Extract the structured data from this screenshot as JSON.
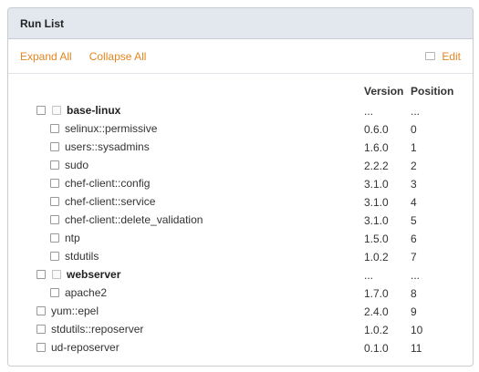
{
  "panel": {
    "title": "Run List"
  },
  "toolbar": {
    "expand_all": "Expand All",
    "collapse_all": "Collapse All",
    "edit": "Edit"
  },
  "table": {
    "headers": {
      "version": "Version",
      "position": "Position"
    },
    "rows": [
      {
        "name": "base-linux",
        "version": "...",
        "position": "...",
        "type": "role",
        "level": 0
      },
      {
        "name": "selinux::permissive",
        "version": "0.6.0",
        "position": "0",
        "type": "recipe",
        "level": 1
      },
      {
        "name": "users::sysadmins",
        "version": "1.6.0",
        "position": "1",
        "type": "recipe",
        "level": 1
      },
      {
        "name": "sudo",
        "version": "2.2.2",
        "position": "2",
        "type": "recipe",
        "level": 1
      },
      {
        "name": "chef-client::config",
        "version": "3.1.0",
        "position": "3",
        "type": "recipe",
        "level": 1
      },
      {
        "name": "chef-client::service",
        "version": "3.1.0",
        "position": "4",
        "type": "recipe",
        "level": 1
      },
      {
        "name": "chef-client::delete_validation",
        "version": "3.1.0",
        "position": "5",
        "type": "recipe",
        "level": 1
      },
      {
        "name": "ntp",
        "version": "1.5.0",
        "position": "6",
        "type": "recipe",
        "level": 1
      },
      {
        "name": "stdutils",
        "version": "1.0.2",
        "position": "7",
        "type": "recipe",
        "level": 1
      },
      {
        "name": "webserver",
        "version": "...",
        "position": "...",
        "type": "role",
        "level": 0
      },
      {
        "name": "apache2",
        "version": "1.7.0",
        "position": "8",
        "type": "recipe",
        "level": 1
      },
      {
        "name": "yum::epel",
        "version": "2.4.0",
        "position": "9",
        "type": "recipe",
        "level": 0
      },
      {
        "name": "stdutils::reposerver",
        "version": "1.0.2",
        "position": "10",
        "type": "recipe",
        "level": 0
      },
      {
        "name": "ud-reposerver",
        "version": "0.1.0",
        "position": "11",
        "type": "recipe",
        "level": 0
      }
    ]
  },
  "colors": {
    "accent": "#e3861f",
    "header_bg": "#e3e8ee",
    "border": "#c9cdd2"
  }
}
